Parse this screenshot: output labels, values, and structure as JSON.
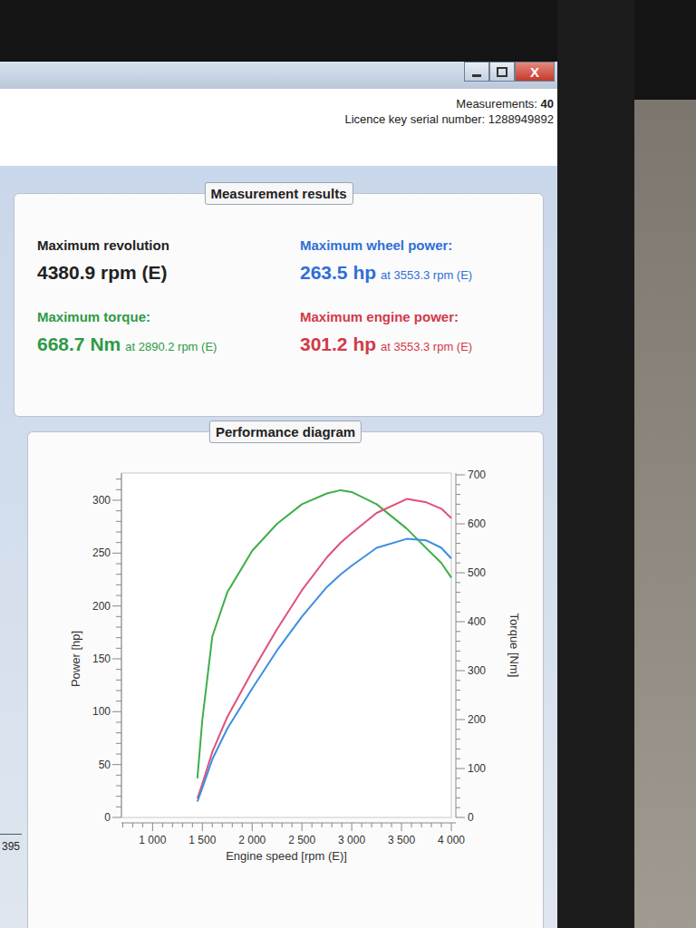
{
  "window": {
    "close_label": "X"
  },
  "header": {
    "measurements_label": "Measurements:",
    "measurements_value": "40",
    "licence": "Licence key serial number: 1288949892"
  },
  "results": {
    "title": "Measurement results",
    "items": [
      {
        "label": "Maximum revolution",
        "value": "4380.9 rpm (E)",
        "color": "#222222"
      },
      {
        "label": "Maximum wheel power:",
        "value": "263.5 hp",
        "at": "at 3553.3 rpm (E)",
        "color": "#2f6fd6"
      },
      {
        "label": "Maximum torque:",
        "value": "668.7 Nm",
        "at": "at 2890.2 rpm (E)",
        "color": "#2e9a45"
      },
      {
        "label": "Maximum engine power:",
        "value": "301.2 hp",
        "at": "at 3553.3 rpm (E)",
        "color": "#d23a4a"
      }
    ]
  },
  "side": {
    "text": "395"
  },
  "chart": {
    "title": "Performance diagram",
    "y_left": {
      "title": "Power [hp]",
      "ticks": [
        "0",
        "50",
        "100",
        "150",
        "200",
        "250",
        "300"
      ]
    },
    "y_right": {
      "title": "Torque [Nm]",
      "ticks": [
        "0",
        "100",
        "200",
        "300",
        "400",
        "500",
        "600",
        "700"
      ]
    },
    "x": {
      "title": "Engine speed [rpm (E)]",
      "ticks": [
        "1 000",
        "1 500",
        "2 000",
        "2 500",
        "3 000",
        "3 500",
        "4 000"
      ]
    },
    "rpm": [
      1450,
      1500,
      1600,
      1750,
      2000,
      2250,
      2500,
      2750,
      2890,
      3000,
      3250,
      3553,
      3750,
      3900,
      4000
    ],
    "series": [
      {
        "kind": "torque",
        "color": "#3fae4a",
        "values": [
          80,
          200,
          370,
          460,
          545,
          600,
          640,
          662,
          668.7,
          665,
          640,
          590,
          550,
          520,
          490
        ]
      },
      {
        "kind": "power",
        "color": "#e0507a",
        "values": [
          18,
          32,
          62,
          95,
          138,
          178,
          215,
          246,
          260,
          269,
          288,
          301.2,
          298,
          292,
          283
        ]
      },
      {
        "kind": "power",
        "color": "#3d8fe0",
        "values": [
          15,
          28,
          55,
          84,
          122,
          158,
          190,
          218,
          230,
          238,
          255,
          263.5,
          262,
          255,
          245
        ]
      }
    ]
  }
}
